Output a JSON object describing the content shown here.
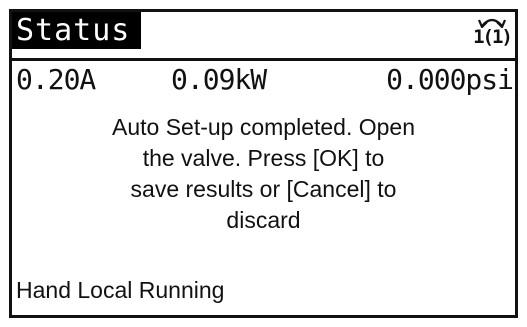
{
  "header": {
    "title": "Status",
    "menu_indicator": {
      "icon": "cycle-arrow-icon",
      "label": "1(1)"
    }
  },
  "readouts": {
    "current": "0.20A",
    "power": "0.09kW",
    "pressure": "0.000psi"
  },
  "message": {
    "lines": [
      "Auto Set-up completed. Open",
      "the valve.  Press [OK] to",
      "save results or [Cancel] to",
      "discard"
    ]
  },
  "footer": {
    "status": "Hand Local Running"
  },
  "colors": {
    "background": "#ffffff",
    "foreground": "#111111",
    "title_background": "#000000",
    "title_text": "#ffffff"
  }
}
